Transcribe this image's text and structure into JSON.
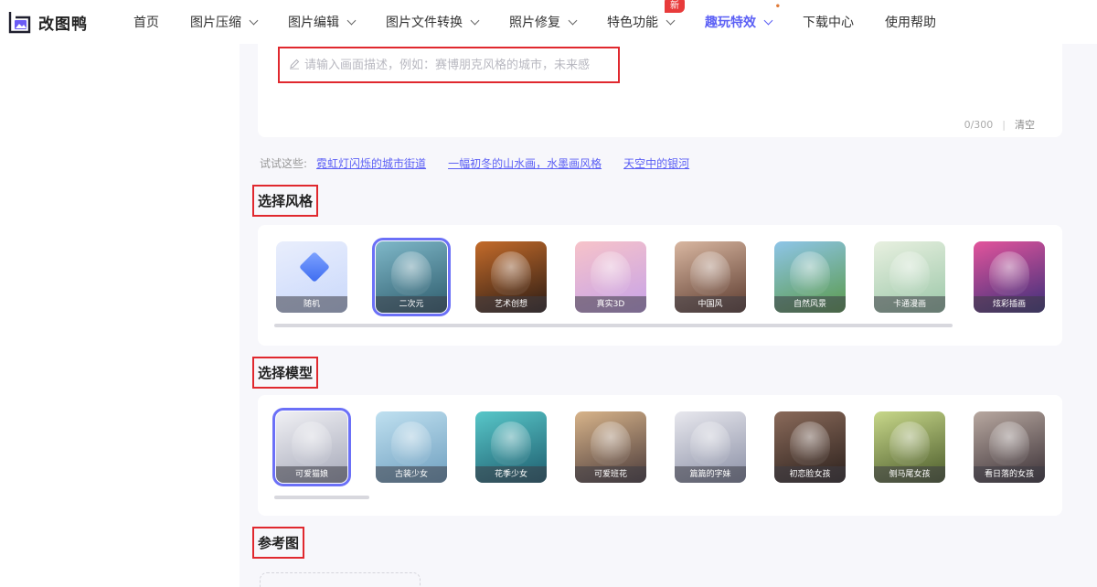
{
  "app": {
    "name": "改图鸭"
  },
  "nav": {
    "items": [
      {
        "label": "首页",
        "chevron": false
      },
      {
        "label": "图片压缩",
        "chevron": true
      },
      {
        "label": "图片编辑",
        "chevron": true
      },
      {
        "label": "图片文件转换",
        "chevron": true
      },
      {
        "label": "照片修复",
        "chevron": true
      },
      {
        "label": "特色功能",
        "chevron": true,
        "badge": "新"
      },
      {
        "label": "趣玩特效",
        "chevron": true,
        "active": true
      },
      {
        "label": "下载中心",
        "chevron": false
      },
      {
        "label": "使用帮助",
        "chevron": false
      }
    ]
  },
  "prompt": {
    "placeholder": "请输入画面描述，例如：赛博朋克风格的城市，未来感",
    "count": "0/300",
    "clear": "清空"
  },
  "suggestions": {
    "label": "试试这些:",
    "items": [
      "霓虹灯闪烁的城市街道",
      "一幅初冬的山水画，水墨画风格",
      "天空中的银河"
    ]
  },
  "style_section": {
    "title": "选择风格",
    "items": [
      {
        "label": "随机",
        "colors": [
          "#e9eefc",
          "#c9d8fb"
        ],
        "selected": false
      },
      {
        "label": "二次元",
        "colors": [
          "#7fb8c9",
          "#2d5b6b"
        ],
        "selected": true
      },
      {
        "label": "艺术创想",
        "colors": [
          "#c46b2a",
          "#2a1b14"
        ],
        "selected": false
      },
      {
        "label": "真实3D",
        "colors": [
          "#f7c3c9",
          "#c6a2e8"
        ],
        "selected": false
      },
      {
        "label": "中国风",
        "colors": [
          "#d9b7a1",
          "#5b3a2e"
        ],
        "selected": false
      },
      {
        "label": "自然风景",
        "colors": [
          "#8ec5e8",
          "#5a9a4a"
        ],
        "selected": false
      },
      {
        "label": "卡通漫画",
        "colors": [
          "#e8f0e0",
          "#9bc7a8"
        ],
        "selected": false
      },
      {
        "label": "炫彩插画",
        "colors": [
          "#e3549c",
          "#3a2f7a"
        ],
        "selected": false
      }
    ]
  },
  "model_section": {
    "title": "选择模型",
    "items": [
      {
        "label": "可爱猫娘",
        "colors": [
          "#f0f0f4",
          "#a5a8b8"
        ],
        "selected": true
      },
      {
        "label": "古装少女",
        "colors": [
          "#bfe0f0",
          "#6f9fbf"
        ],
        "selected": false
      },
      {
        "label": "花季少女",
        "colors": [
          "#58c7c9",
          "#1e5d6e"
        ],
        "selected": false
      },
      {
        "label": "可爱班花",
        "colors": [
          "#d8b48a",
          "#4a3a3a"
        ],
        "selected": false
      },
      {
        "label": "篇篇的字妹",
        "colors": [
          "#e8e8ee",
          "#8a8fa5"
        ],
        "selected": false
      },
      {
        "label": "初恋脸女孩",
        "colors": [
          "#8a6a5a",
          "#2b201c"
        ],
        "selected": false
      },
      {
        "label": "侧马尾女孩",
        "colors": [
          "#c8d88a",
          "#4a5a2a"
        ],
        "selected": false
      },
      {
        "label": "看日落的女孩",
        "colors": [
          "#b8a8a0",
          "#3a3036"
        ],
        "selected": false
      }
    ]
  },
  "reference_section": {
    "title": "参考图"
  },
  "colors": {
    "accent": "#5b5ff5",
    "highlight_border": "#e0282e",
    "badge": "#e83b3b"
  }
}
